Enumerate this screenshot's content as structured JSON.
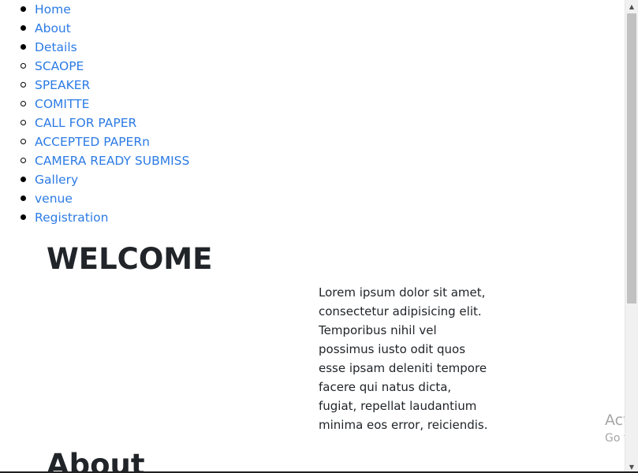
{
  "nav": {
    "items": [
      {
        "label": "Home",
        "bullet": "disc"
      },
      {
        "label": "About",
        "bullet": "disc"
      },
      {
        "label": "Details",
        "bullet": "disc"
      },
      {
        "label": "SCAOPE",
        "bullet": "circle"
      },
      {
        "label": "SPEAKER",
        "bullet": "circle"
      },
      {
        "label": "COMITTE",
        "bullet": "circle"
      },
      {
        "label": "CALL FOR PAPER",
        "bullet": "circle"
      },
      {
        "label": "ACCEPTED PAPERn",
        "bullet": "circle"
      },
      {
        "label": "CAMERA READY SUBMISS",
        "bullet": "circle"
      },
      {
        "label": "Gallery",
        "bullet": "disc"
      },
      {
        "label": "venue",
        "bullet": "disc"
      },
      {
        "label": "Registration",
        "bullet": "disc"
      }
    ]
  },
  "welcome": {
    "title": "WELCOME",
    "lines": [
      "Lorem ipsum dolor sit amet,",
      "consectetur adipisicing elit.",
      "Temporibus nihil vel",
      "possimus iusto odit quos",
      "esse ipsam deleniti tempore",
      "facere qui natus dicta,",
      "fugiat, repellat laudantium",
      "minima eos error, reiciendis."
    ]
  },
  "about": {
    "title": "About"
  },
  "watermark": {
    "line1": "Activ",
    "line2": "Go to"
  },
  "colors": {
    "link": "#2c7be5",
    "text": "#212529",
    "watermark": "#a6a6a6"
  }
}
